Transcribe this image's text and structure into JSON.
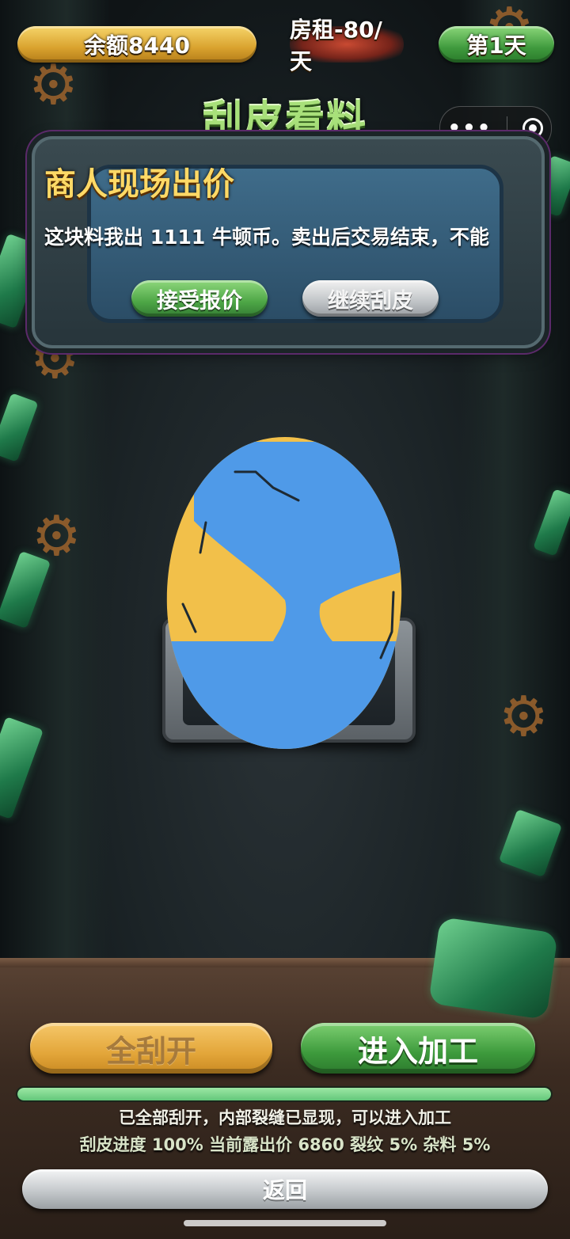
{
  "top_bar": {
    "balance": "余额8440",
    "rent": "房租-80/天",
    "day": "第1天"
  },
  "page_title": "刮皮看料",
  "mini_program_capsule": {
    "more_icon": "more-dots-icon",
    "close_icon": "target-circle-icon"
  },
  "dialog": {
    "title": "商人现场出价",
    "message": "这块料我出 1111 牛顿币。卖出后交易结束，不能",
    "accept_label": "接受报价",
    "continue_label": "继续刮皮"
  },
  "stone": {
    "scrape_progress_fraction": 1.0,
    "skin_color": "#f2c04a",
    "exposed_color": "#4f9ae8"
  },
  "actions": {
    "scrape_all_label": "全刮开",
    "process_label": "进入加工"
  },
  "progress": {
    "fraction": 1.0,
    "bar_color": "#7ed89a"
  },
  "status": {
    "line1": "已全部刮开，内部裂缝已显现，可以进入加工",
    "line2": "刮皮进度 100% 当前露出价 6860 裂纹 5% 杂料 5%"
  },
  "back_label": "返回"
}
